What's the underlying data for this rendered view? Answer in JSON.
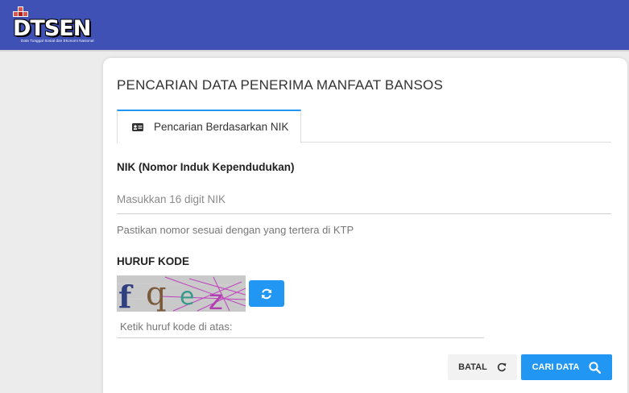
{
  "header": {
    "logo_text": "DTSEN",
    "logo_subtitle": "Data Tunggal Sosial dan Ekonomi Nasional",
    "background_color": "#3f51b5"
  },
  "form": {
    "title": "PENCARIAN DATA PENERIMA MANFAAT BANSOS",
    "tab": {
      "label": "Pencarian Berdasarkan NIK",
      "icon": "id-card-icon"
    },
    "nik_label": "NIK (Nomor Induk Kependudukan)",
    "nik_placeholder": "Masukkan 16 digit NIK",
    "nik_value": "",
    "nik_hint": "Pastikan nomor sesuai dengan yang tertera di KTP",
    "captcha_label": "HURUF KODE",
    "captcha_text": "fqez",
    "captcha_placeholder": "Ketik huruf kode di atas:",
    "captcha_value": "",
    "refresh_icon": "refresh-icon",
    "batal_label": "BATAL",
    "cari_label": "CARI DATA",
    "accent_color": "#2196f3"
  }
}
